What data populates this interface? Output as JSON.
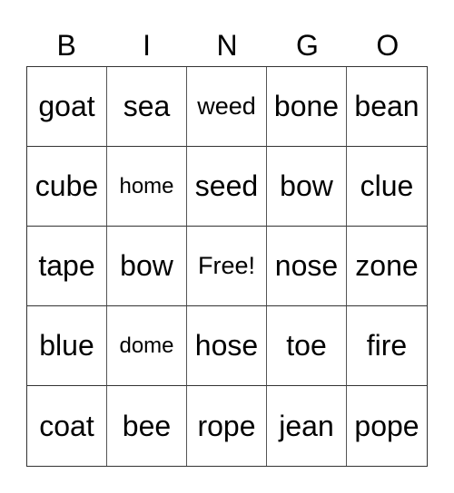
{
  "header": [
    "B",
    "I",
    "N",
    "G",
    "O"
  ],
  "rows": [
    [
      "goat",
      "sea",
      "weed",
      "bone",
      "bean"
    ],
    [
      "cube",
      "home",
      "seed",
      "bow",
      "clue"
    ],
    [
      "tape",
      "bow",
      "Free!",
      "nose",
      "zone"
    ],
    [
      "blue",
      "dome",
      "hose",
      "toe",
      "fire"
    ],
    [
      "coat",
      "bee",
      "rope",
      "jean",
      "pope"
    ]
  ]
}
